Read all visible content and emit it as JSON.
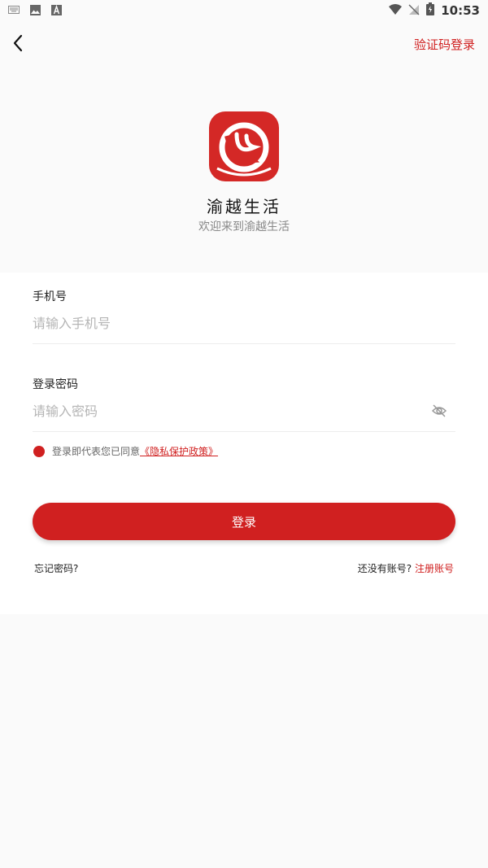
{
  "status_bar": {
    "time": "10:53"
  },
  "nav": {
    "switch_login": "验证码登录"
  },
  "app": {
    "name": "渝越生活",
    "welcome": "欢迎来到渝越生活"
  },
  "form": {
    "phone_label": "手机号",
    "phone_placeholder": "请输入手机号",
    "password_label": "登录密码",
    "password_placeholder": "请输入密码"
  },
  "agreement": {
    "text": "登录即代表您已同意",
    "link": "《隐私保护政策》"
  },
  "actions": {
    "login_label": "登录",
    "forgot_label": "忘记密码?",
    "register_prompt": "还没有账号?",
    "register_label": "注册账号"
  },
  "colors": {
    "accent": "#d02020",
    "logo_bg": "#d42826"
  }
}
